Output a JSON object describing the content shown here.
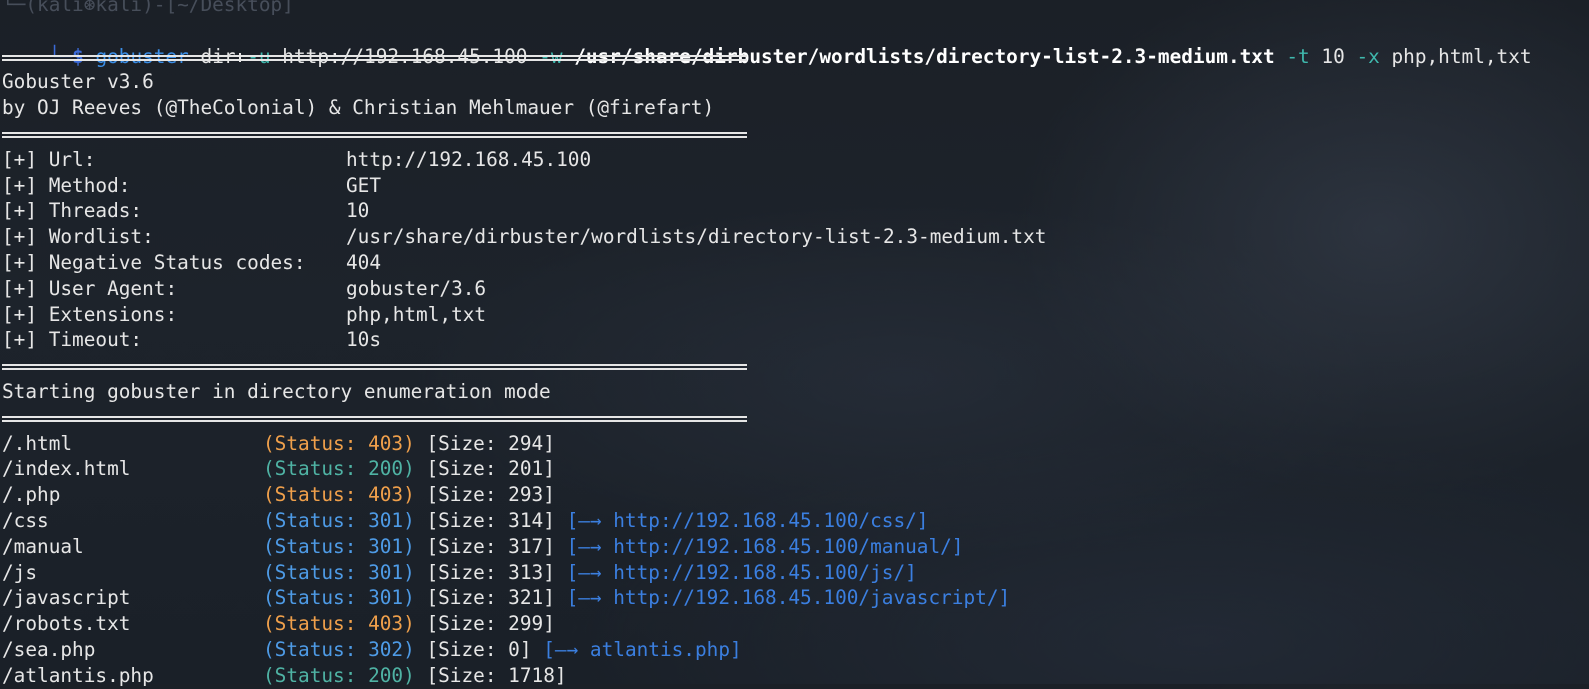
{
  "header_ghost": "└─(kali⊛kali)-[~/Desktop]",
  "prompt": {
    "corner": "└─",
    "dollar": "$",
    "cmd": "gobuster",
    "args": [
      {
        "text": "dir",
        "kind": "arg"
      },
      {
        "text": "-u",
        "kind": "flag"
      },
      {
        "text": "http://192.168.45.100",
        "kind": "arg"
      },
      {
        "text": "-w",
        "kind": "flag"
      },
      {
        "text": "/usr/share/dirbuster/wordlists/directory-list-2.3-medium.txt",
        "kind": "bold"
      },
      {
        "text": "-t",
        "kind": "flag"
      },
      {
        "text": "10",
        "kind": "arg"
      },
      {
        "text": "-x",
        "kind": "flag"
      },
      {
        "text": "php,html,txt",
        "kind": "arg"
      }
    ]
  },
  "banner": {
    "version": "Gobuster v3.6",
    "authors": "by OJ Reeves (@TheColonial) & Christian Mehlmauer (@firefart)"
  },
  "config": [
    {
      "key": "[+] Url:",
      "value": "http://192.168.45.100"
    },
    {
      "key": "[+] Method:",
      "value": "GET"
    },
    {
      "key": "[+] Threads:",
      "value": "10"
    },
    {
      "key": "[+] Wordlist:",
      "value": "/usr/share/dirbuster/wordlists/directory-list-2.3-medium.txt"
    },
    {
      "key": "[+] Negative Status codes:",
      "value": "404"
    },
    {
      "key": "[+] User Agent:",
      "value": "gobuster/3.6"
    },
    {
      "key": "[+] Extensions:",
      "value": "php,html,txt"
    },
    {
      "key": "[+] Timeout:",
      "value": "10s"
    }
  ],
  "mode_message": "Starting gobuster in directory enumeration mode",
  "results": [
    {
      "path": "/.html",
      "status": "(Status: 403)",
      "color": "orange",
      "size": "[Size: 294]",
      "redirect": ""
    },
    {
      "path": "/index.html",
      "status": "(Status: 200)",
      "color": "green",
      "size": "[Size: 201]",
      "redirect": ""
    },
    {
      "path": "/.php",
      "status": "(Status: 403)",
      "color": "orange",
      "size": "[Size: 293]",
      "redirect": ""
    },
    {
      "path": "/css",
      "status": "(Status: 301)",
      "color": "blue",
      "size": "[Size: 314]",
      "redirect": "[—→ http://192.168.45.100/css/]"
    },
    {
      "path": "/manual",
      "status": "(Status: 301)",
      "color": "blue",
      "size": "[Size: 317]",
      "redirect": "[—→ http://192.168.45.100/manual/]"
    },
    {
      "path": "/js",
      "status": "(Status: 301)",
      "color": "blue",
      "size": "[Size: 313]",
      "redirect": "[—→ http://192.168.45.100/js/]"
    },
    {
      "path": "/javascript",
      "status": "(Status: 301)",
      "color": "blue",
      "size": "[Size: 321]",
      "redirect": "[—→ http://192.168.45.100/javascript/]"
    },
    {
      "path": "/robots.txt",
      "status": "(Status: 403)",
      "color": "orange",
      "size": "[Size: 299]",
      "redirect": ""
    },
    {
      "path": "/sea.php",
      "status": "(Status: 302)",
      "color": "blue",
      "size": "[Size: 0]",
      "redirect": "[—→ atlantis.php]"
    },
    {
      "path": "/atlantis.php",
      "status": "(Status: 200)",
      "color": "green",
      "size": "[Size: 1718]",
      "redirect": ""
    }
  ],
  "colors": {
    "orange": "#f0a04b",
    "green": "#4fb3a4",
    "blue": "#4e9be6"
  }
}
